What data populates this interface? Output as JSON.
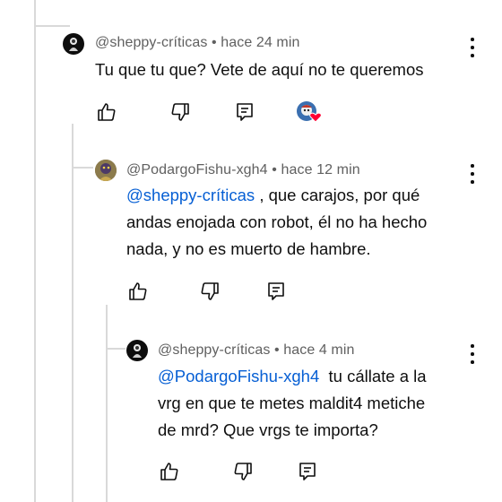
{
  "comments": [
    {
      "handle": "@sheppy-críticas",
      "sep": "•",
      "time": "hace 24 min",
      "text": "Tu que tu que? Vete de aquí no te queremos",
      "creator_heart": true
    },
    {
      "handle": "@PodargoFishu-xgh4",
      "sep": "•",
      "time": "hace 12 min",
      "mention": "@sheppy-críticas",
      "text_line1": " , que carajos, por qué",
      "text_line2": "andas enojada con robot, él no ha hecho",
      "text_line3": "nada, y no es muerto de hambre."
    },
    {
      "handle": "@sheppy-críticas",
      "sep": "•",
      "time": "hace 4 min",
      "mention": "@PodargoFishu-xgh4",
      "text_line1": "  tu cállate a la",
      "text_line2": "vrg en que te metes maldit4 metiche",
      "text_line3": "de mrd? Que vrgs te importa?"
    }
  ],
  "icons": {
    "like": "thumbs-up-icon",
    "dislike": "thumbs-down-icon",
    "reply": "reply-icon",
    "more": "more-vert-icon",
    "heart": "creator-heart-icon"
  },
  "colors": {
    "mention": "#065fd4",
    "meta": "#606060",
    "heart": "#ff0033"
  }
}
